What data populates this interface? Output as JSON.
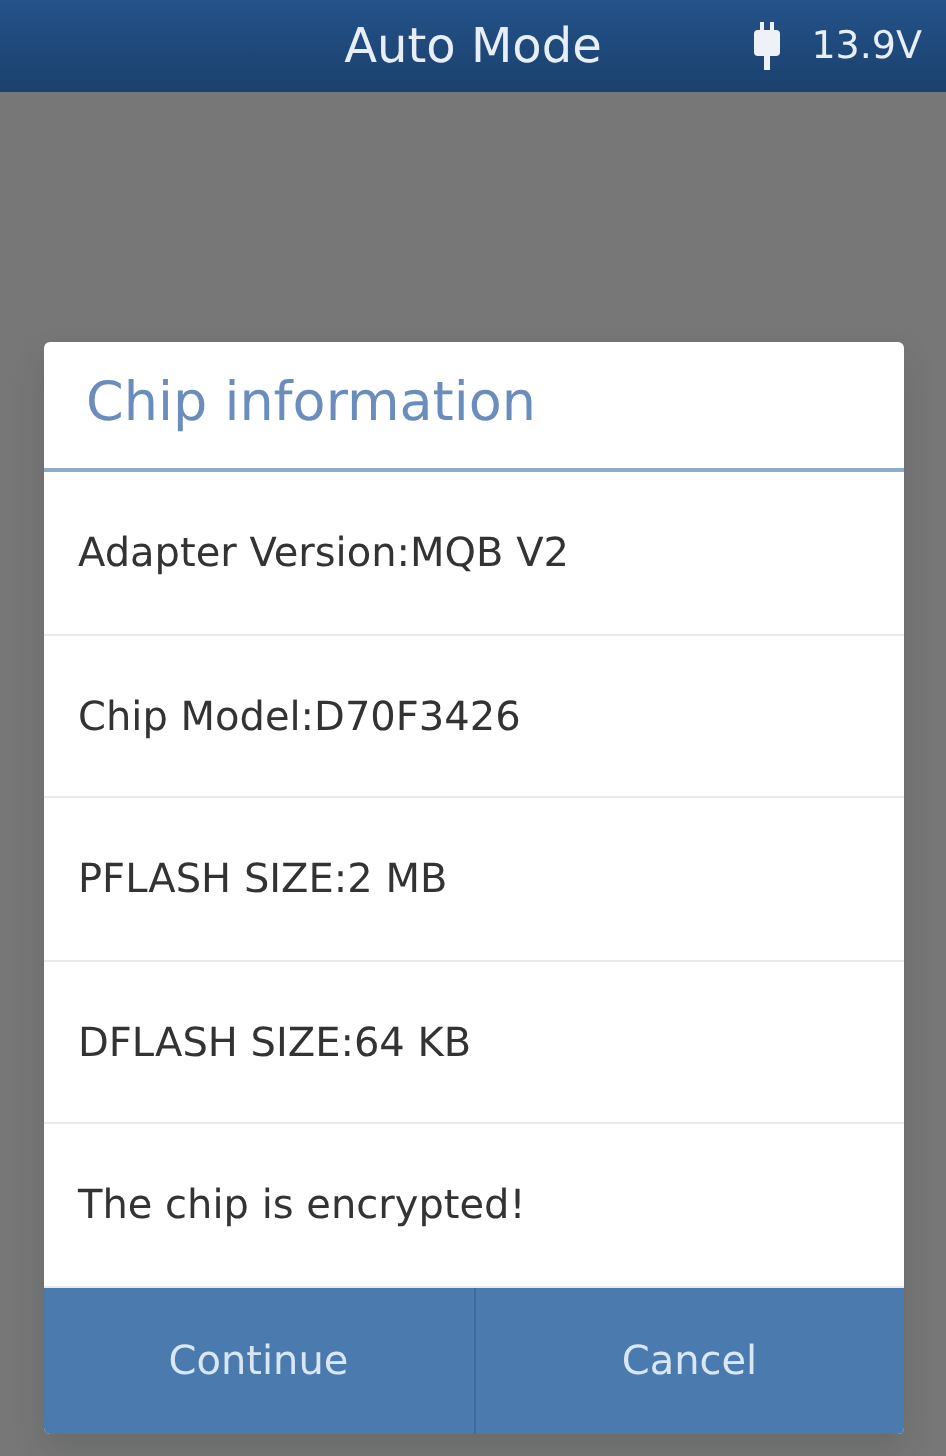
{
  "top_bar": {
    "title": "Auto Mode",
    "voltage": "13.9V"
  },
  "dialog": {
    "title": "Chip information",
    "lines": [
      "Adapter Version:MQB V2",
      "Chip Model:D70F3426",
      "PFLASH SIZE:2 MB",
      "DFLASH SIZE:64 KB",
      "The chip is encrypted!"
    ],
    "buttons": [
      "Continue",
      "Cancel"
    ]
  }
}
